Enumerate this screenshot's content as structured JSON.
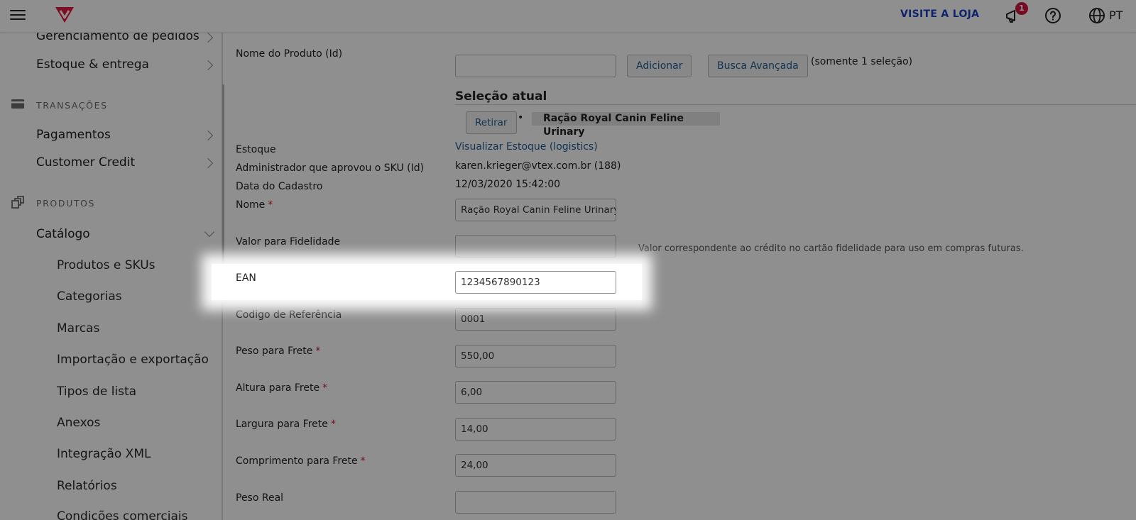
{
  "topbar": {
    "visit_store": "VISITE A LOJA",
    "notification_count": "1",
    "language": "PT",
    "brand_color": "#e3193f",
    "link_color": "#1a3fbf"
  },
  "sidebar": {
    "items_top": [
      {
        "label": "Gerenciamento de pedidos"
      },
      {
        "label": "Estoque & entrega"
      }
    ],
    "transacoes": {
      "heading": "TRANSAÇÕES",
      "items": [
        {
          "label": "Pagamentos"
        },
        {
          "label": "Customer Credit"
        }
      ]
    },
    "produtos": {
      "heading": "PRODUTOS",
      "catalog_label": "Catálogo",
      "sub_items": [
        {
          "label": "Produtos e SKUs"
        },
        {
          "label": "Categorias"
        },
        {
          "label": "Marcas"
        },
        {
          "label": "Importação e exportação"
        },
        {
          "label": "Tipos de lista"
        },
        {
          "label": "Anexos"
        },
        {
          "label": "Integração XML"
        },
        {
          "label": "Relatórios"
        },
        {
          "label": "Condições comerciais"
        }
      ]
    }
  },
  "form": {
    "product_name_label": "Nome do Produto (Id)",
    "product_name_value": "",
    "add_button": "Adicionar",
    "advanced_search_button": "Busca Avançada",
    "single_selection_note": "(somente 1 seleção)",
    "current_selection_title": "Seleção atual",
    "remove_button": "Retirar",
    "bullet": "•",
    "selected_product": "Ração Royal Canin Feline Urinary",
    "stock_label": "Estoque",
    "stock_link": "Visualizar Estoque (logistics)",
    "approver_label": "Administrador que aprovou o SKU (Id)",
    "approver_value": "karen.krieger@vtex.com.br (188)",
    "created_label": "Data do Cadastro",
    "created_value": "12/03/2020 15:42:00",
    "name_label": "Nome",
    "name_value": "Ração Royal Canin Feline Urinary",
    "loyalty_label": "Valor para Fidelidade",
    "loyalty_value": "",
    "loyalty_hint": "Valor correspondente ao crédito no cartão fidelidade para uso em compras futuras.",
    "ean_label": "EAN",
    "ean_value": "1234567890123",
    "ref_label": "Codigo de Referência",
    "ref_value": "0001",
    "weight_label": "Peso para Frete",
    "weight_value": "550,00",
    "height_label": "Altura para Frete",
    "height_value": "6,00",
    "width_label": "Largura para Frete",
    "width_value": "14,00",
    "length_label": "Comprimento para Frete",
    "length_value": "24,00",
    "real_weight_label": "Peso Real",
    "real_weight_value": "",
    "required_mark": "*"
  }
}
